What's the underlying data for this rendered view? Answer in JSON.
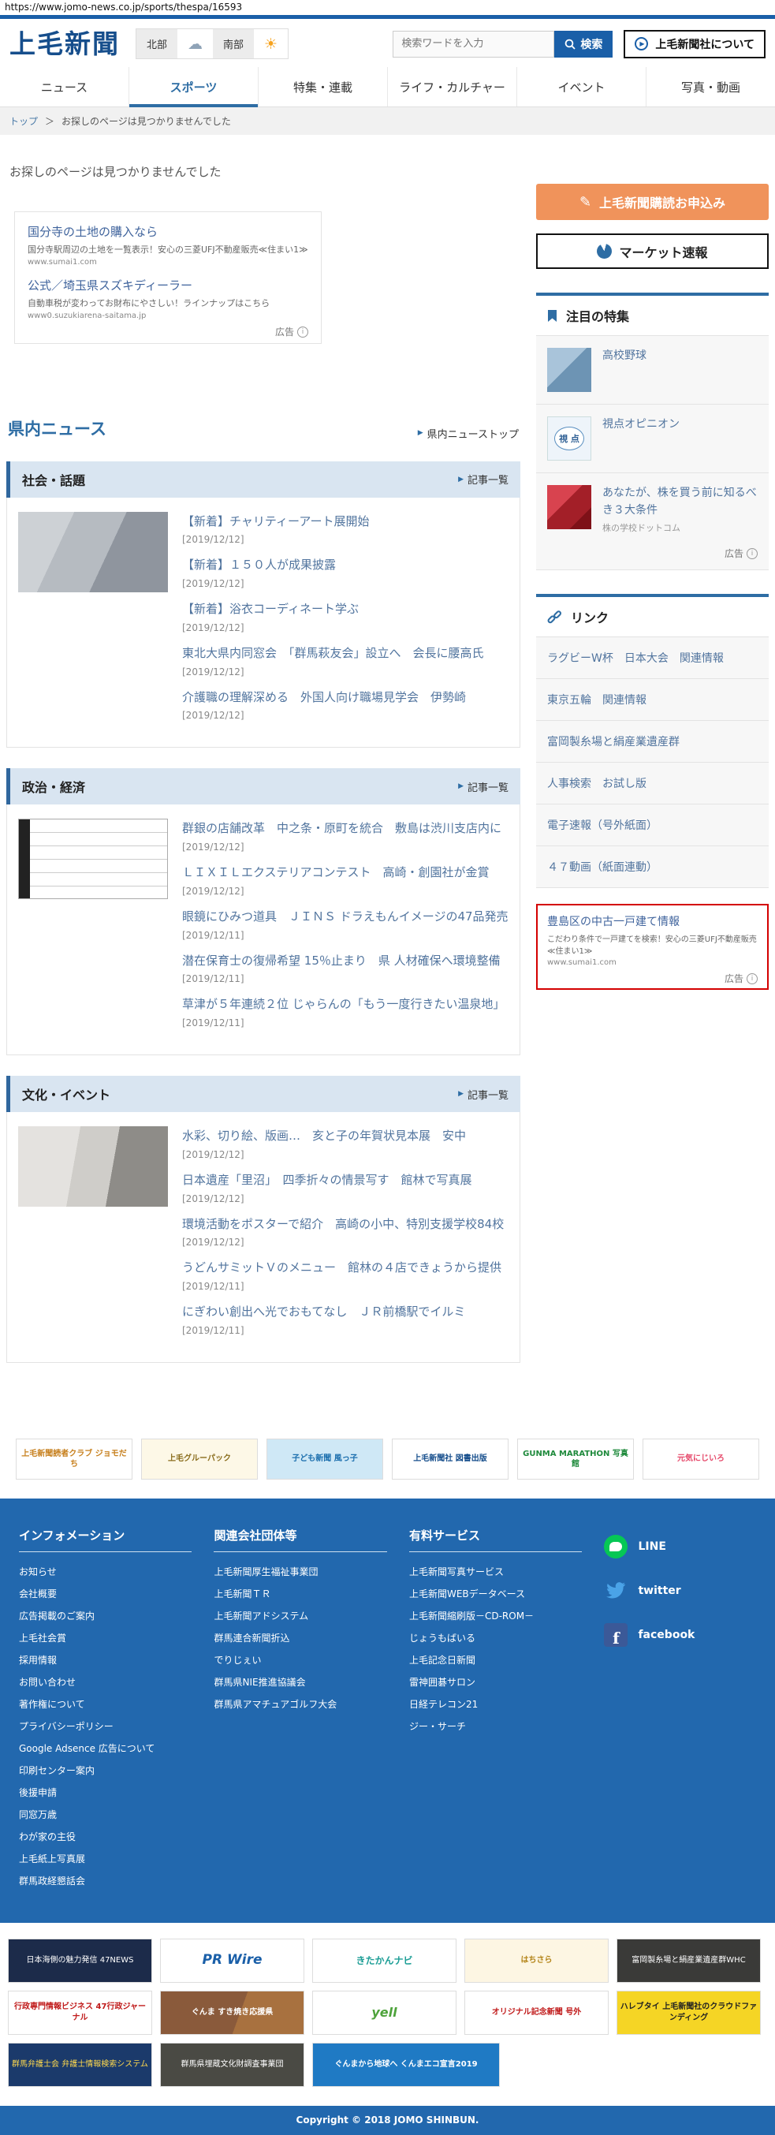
{
  "browser": {
    "url": "https://www.jomo-news.co.jp/sports/thespa/16593"
  },
  "header": {
    "logo": "上毛新聞",
    "weather": {
      "north": "北部",
      "south": "南部"
    },
    "search_placeholder": "検索ワードを入力",
    "search_button": "検索",
    "about_button": "上毛新聞社について"
  },
  "nav": {
    "items": [
      {
        "label": "ニュース"
      },
      {
        "label": "スポーツ"
      },
      {
        "label": "特集・連載"
      },
      {
        "label": "ライフ・カルチャー"
      },
      {
        "label": "イベント"
      },
      {
        "label": "写真・動画"
      }
    ]
  },
  "breadcrumb": {
    "home": "トップ",
    "separator": "＞",
    "current": "お探しのページは見つかりませんでした"
  },
  "main": {
    "not_found": "お探しのページは見つかりませんでした",
    "ad_label": "広告",
    "text_ads": [
      {
        "title": "国分寺の土地の購入なら",
        "description": "国分寺駅周辺の土地を一覧表示！安心の三菱UFJ不動産販売≪住まい1≫",
        "display_url": "www.sumai1.com"
      },
      {
        "title": "公式／埼玉県スズキディーラー",
        "description": "自動車税が変わってお財布にやさしい！ラインナップはこちら",
        "display_url": "www0.suzukiarena-saitama.jp"
      }
    ],
    "local_news_title": "県内ニュース",
    "local_news_top_link": "県内ニューストップ",
    "sections": [
      {
        "title": "社会・話題",
        "list_link": "記事一覧",
        "articles": [
          {
            "title": "【新着】チャリティーアート展開始",
            "date": "[2019/12/12]"
          },
          {
            "title": "【新着】１５０人が成果披露",
            "date": "[2019/12/12]"
          },
          {
            "title": "【新着】浴衣コーディネート学ぶ",
            "date": "[2019/12/12]"
          },
          {
            "title": "東北大県内同窓会　「群馬萩友会」設立へ　会長に腰高氏",
            "date": "[2019/12/12]"
          },
          {
            "title": "介護職の理解深める　外国人向け職場見学会　伊勢崎",
            "date": "[2019/12/12]"
          }
        ]
      },
      {
        "title": "政治・経済",
        "list_link": "記事一覧",
        "articles": [
          {
            "title": "群銀の店舗改革　中之条・原町を統合　敷島は渋川支店内に",
            "date": "[2019/12/12]"
          },
          {
            "title": "ＬＩＸＩＬエクステリアコンテスト　高崎・創園社が金賞",
            "date": "[2019/12/12]"
          },
          {
            "title": "眼鏡にひみつ道具　ＪＩＮＳ ドラえもんイメージの47品発売",
            "date": "[2019/12/11]"
          },
          {
            "title": "潜在保育士の復帰希望 15％止まり　県 人材確保へ環境整備",
            "date": "[2019/12/11]"
          },
          {
            "title": "草津が５年連続２位 じゃらんの「もう一度行きたい温泉地」",
            "date": "[2019/12/11]"
          }
        ]
      },
      {
        "title": "文化・イベント",
        "list_link": "記事一覧",
        "articles": [
          {
            "title": "水彩、切り絵、版画…　亥と子の年賀状見本展　安中",
            "date": "[2019/12/12]"
          },
          {
            "title": "日本遺産「里沼」　四季折々の情景写す　館林で写真展",
            "date": "[2019/12/12]"
          },
          {
            "title": "環境活動をポスターで紹介　高崎の小中、特別支援学校84校",
            "date": "[2019/12/12]"
          },
          {
            "title": "うどんサミットＶのメニュー　館林の４店できょうから提供",
            "date": "[2019/12/11]"
          },
          {
            "title": "にぎわい創出へ光でおもてなし　ＪＲ前橋駅でイルミ",
            "date": "[2019/12/11]"
          }
        ]
      }
    ]
  },
  "sidebar": {
    "subscribe_button": "上毛新聞購読お申込み",
    "market_button": "マーケット速報",
    "featured": {
      "title": "注目の特集",
      "items": [
        {
          "label": "高校野球"
        },
        {
          "label": "視点オピニオン",
          "logo_text": "視 点"
        },
        {
          "label": "あなたが、株を買う前に知るべき３大条件",
          "sub_label": "株の学校ドットコム"
        }
      ],
      "ad_label": "広告"
    },
    "links": {
      "title": "リンク",
      "items": [
        {
          "label": "ラグビーW杯　日本大会　関連情報"
        },
        {
          "label": "東京五輪　関連情報"
        },
        {
          "label": "富岡製糸場と絹産業遺産群"
        },
        {
          "label": "人事検索　お試し版"
        },
        {
          "label": "電子速報（号外紙面）"
        },
        {
          "label": "４７動画（紙面連動）"
        }
      ]
    },
    "red_ad": {
      "title": "豊島区の中古一戸建て情報",
      "description": "こだわり条件で一戸建てを検索！安心の三菱UFJ不動産販売≪住まい1≫",
      "display_url": "www.sumai1.com",
      "ad_label": "広告"
    }
  },
  "mid_banners": [
    {
      "label": "上毛新聞読者クラブ ジョモだち"
    },
    {
      "label": "上毛グルーパック"
    },
    {
      "label": "子ども新聞 風っ子"
    },
    {
      "label": "上毛新聞社 図書出版"
    },
    {
      "label": "GUNMA MARATHON 写真館"
    },
    {
      "label": "元気にじいろ"
    }
  ],
  "footer": {
    "columns": [
      {
        "heading": "インフォメーション",
        "links": [
          {
            "label": "お知らせ"
          },
          {
            "label": "会社概要"
          },
          {
            "label": "広告掲載のご案内"
          },
          {
            "label": "上毛社会賞"
          },
          {
            "label": "採用情報"
          },
          {
            "label": "お問い合わせ"
          },
          {
            "label": "著作権について"
          },
          {
            "label": "プライバシーポリシー"
          },
          {
            "label": "Google Adsence 広告について"
          },
          {
            "label": "印刷センター案内"
          },
          {
            "label": "後援申請"
          },
          {
            "label": "同窓万歳"
          },
          {
            "label": "わが家の主役"
          },
          {
            "label": "上毛紙上写真展"
          },
          {
            "label": "群馬政経懇話会"
          }
        ]
      },
      {
        "heading": "関連会社団体等",
        "links": [
          {
            "label": "上毛新聞厚生福祉事業団"
          },
          {
            "label": "上毛新聞ＴＲ"
          },
          {
            "label": "上毛新聞アドシステム"
          },
          {
            "label": "群馬連合新聞折込"
          },
          {
            "label": "でりじぇい"
          },
          {
            "label": "群馬県NIE推進協議会"
          },
          {
            "label": "群馬県アマチュアゴルフ大会"
          }
        ]
      },
      {
        "heading": "有料サービス",
        "links": [
          {
            "label": "上毛新聞写真サービス"
          },
          {
            "label": "上毛新聞WEBデータベース"
          },
          {
            "label": "上毛新聞縮刷版－CD-ROM－"
          },
          {
            "label": "じょうもばいる"
          },
          {
            "label": "上毛記念日新聞"
          },
          {
            "label": "雷神囲碁サロン"
          },
          {
            "label": "日経テレコン21"
          },
          {
            "label": "ジー・サーチ"
          }
        ]
      }
    ],
    "social": [
      {
        "label": "LINE"
      },
      {
        "label": "twitter"
      },
      {
        "label": "facebook"
      }
    ],
    "copyright": "Copyright © 2018 JOMO SHINBUN."
  },
  "bottom_banners": {
    "row1": [
      {
        "label": "日本海側の魅力発信 47NEWS"
      },
      {
        "label": "PR Wire"
      },
      {
        "label": "きたかんナビ"
      },
      {
        "label": "はちさら"
      },
      {
        "label": "富岡製糸場と絹産業遺産群WHC"
      }
    ],
    "row2": [
      {
        "label": "行政専門情報ビジネス 47行政ジャーナル"
      },
      {
        "label": "ぐんま すき焼き応援県"
      },
      {
        "label": "yell"
      },
      {
        "label": "オリジナル記念新聞 号外"
      },
      {
        "label": "ハレブタイ 上毛新聞社のクラウドファンディング"
      }
    ],
    "row3": [
      {
        "label": "群馬弁護士会 弁護士情報検索システム"
      },
      {
        "label": "群馬県埋蔵文化財調査事業団"
      },
      {
        "label": "ぐんまから地球へ くんまエコ宣言2019"
      }
    ]
  }
}
